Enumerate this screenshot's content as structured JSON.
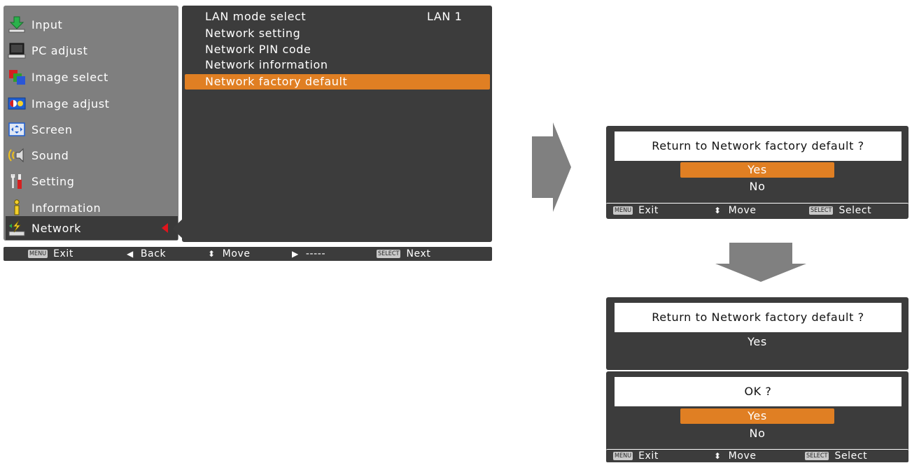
{
  "main_menu": {
    "items": [
      {
        "label": "Input",
        "icon": "input-icon"
      },
      {
        "label": "PC adjust",
        "icon": "pc-adjust-icon"
      },
      {
        "label": "Image select",
        "icon": "image-select-icon"
      },
      {
        "label": "Image adjust",
        "icon": "image-adjust-icon"
      },
      {
        "label": "Screen",
        "icon": "screen-icon"
      },
      {
        "label": "Sound",
        "icon": "sound-icon"
      },
      {
        "label": "Setting",
        "icon": "setting-icon"
      },
      {
        "label": "Information",
        "icon": "information-icon"
      },
      {
        "label": "Network",
        "icon": "network-icon",
        "selected": true
      }
    ]
  },
  "submenu": {
    "items": [
      {
        "label": "LAN mode select",
        "value": "LAN 1"
      },
      {
        "label": "Network setting"
      },
      {
        "label": "Network PIN code"
      },
      {
        "label": "Network information"
      },
      {
        "label": "Network factory default",
        "selected": true
      }
    ]
  },
  "main_bar": {
    "exit_key": "MENU",
    "exit": "Exit",
    "back": "Back",
    "move": "Move",
    "dashes": "-----",
    "next_key": "SELECT",
    "next": "Next"
  },
  "confirm_dialog": {
    "title": "Return to Network factory default ?",
    "yes": "Yes",
    "no": "No",
    "selected": "Yes"
  },
  "dialog_bar": {
    "exit_key": "MENU",
    "exit": "Exit",
    "move": "Move",
    "select_key": "SELECT",
    "select": "Select"
  },
  "result_dialog": {
    "title": "Return to Network factory default ?",
    "value": "Yes"
  },
  "ok_dialog": {
    "title": "OK ?",
    "yes": "Yes",
    "no": "No",
    "selected": "Yes"
  },
  "colors": {
    "highlight": "#e07f23",
    "panel_dark": "#3c3c3c",
    "panel_gray": "#7f7f7f",
    "pointer_red": "#e0141c"
  }
}
